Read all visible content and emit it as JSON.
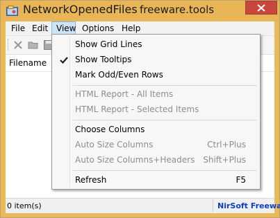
{
  "window": {
    "title": "NetworkOpenedFiles",
    "title_extra": "freeware.tools"
  },
  "menubar": {
    "items": [
      "File",
      "Edit",
      "View",
      "Options",
      "Help"
    ],
    "active": "View"
  },
  "toolbar": {
    "buttons": [
      "delete-icon",
      "open-folder-icon",
      "save-icon"
    ]
  },
  "listview": {
    "columns": [
      "Filename"
    ]
  },
  "view_menu": {
    "items": [
      {
        "label": "Show Grid Lines",
        "checked": false,
        "enabled": true
      },
      {
        "label": "Show Tooltips",
        "checked": true,
        "enabled": true
      },
      {
        "label": "Mark Odd/Even Rows",
        "checked": false,
        "enabled": true
      },
      {
        "label": "HTML Report - All Items",
        "checked": false,
        "enabled": false
      },
      {
        "label": "HTML Report - Selected Items",
        "checked": false,
        "enabled": false
      },
      {
        "label": "Choose Columns",
        "checked": false,
        "enabled": true
      },
      {
        "label": "Auto Size Columns",
        "shortcut": "Ctrl+Plus",
        "checked": false,
        "enabled": false
      },
      {
        "label": "Auto Size Columns+Headers",
        "shortcut": "Shift+Plus",
        "checked": false,
        "enabled": false
      },
      {
        "label": "Refresh",
        "shortcut": "F5",
        "checked": false,
        "enabled": true
      }
    ]
  },
  "statusbar": {
    "left": "0 item(s)",
    "right": "NirSoft Freeware"
  },
  "colors": {
    "titlebar": "#e8b557",
    "close_button": "#c7473c",
    "menu_highlight": "#cde4f7",
    "status_link": "#0b3ec9",
    "disabled_text": "#8d8d8d"
  }
}
